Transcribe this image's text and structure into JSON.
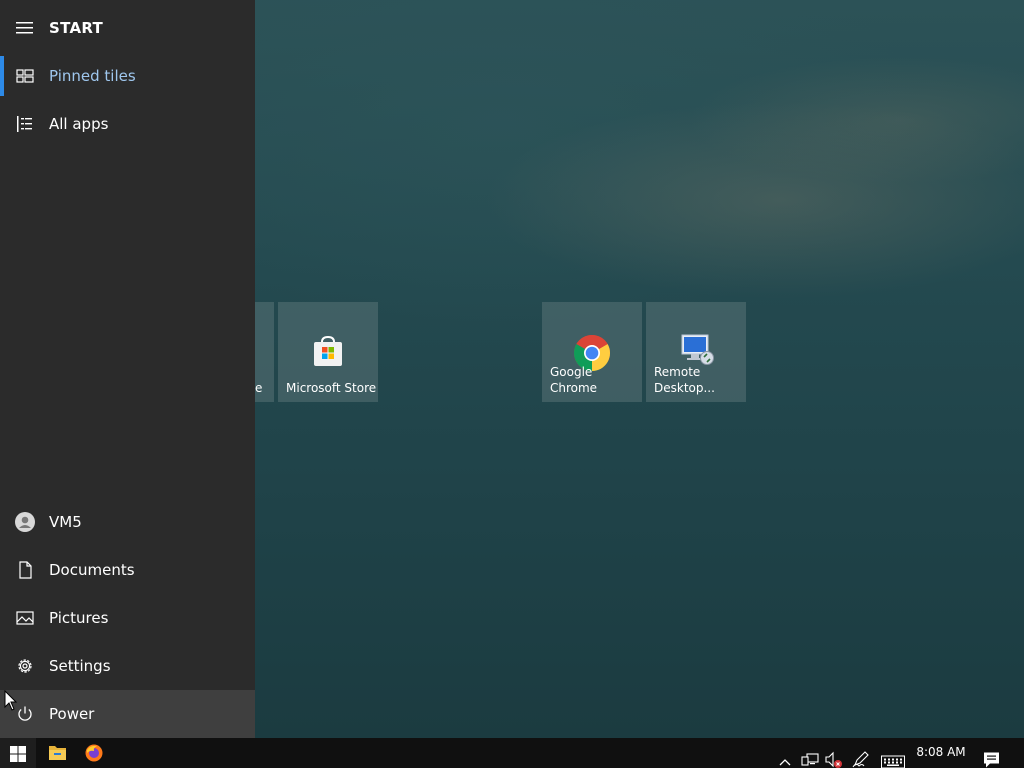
{
  "start_menu": {
    "title": "START",
    "nav_top": [
      {
        "label": "Pinned tiles",
        "icon": "pinned-tiles-icon",
        "selected": true
      },
      {
        "label": "All apps",
        "icon": "all-apps-icon",
        "selected": false
      }
    ],
    "nav_bottom": [
      {
        "label": "VM5",
        "icon": "user-avatar-icon"
      },
      {
        "label": "Documents",
        "icon": "document-icon"
      },
      {
        "label": "Pictures",
        "icon": "pictures-icon"
      },
      {
        "label": "Settings",
        "icon": "gear-icon"
      },
      {
        "label": "Power",
        "icon": "power-icon"
      }
    ]
  },
  "tiles": [
    {
      "label": "e",
      "icon": ""
    },
    {
      "label": "Microsoft Store",
      "icon": "microsoft-store-icon"
    },
    {
      "label": "Google Chrome",
      "icon": "chrome-icon"
    },
    {
      "label": "Remote Desktop...",
      "label_line1": "Remote",
      "label_line2": "Desktop...",
      "icon": "remote-desktop-icon"
    }
  ],
  "taskbar": {
    "apps": [
      "windows-start-icon",
      "file-explorer-icon",
      "firefox-icon"
    ],
    "tray": [
      "chevron-up-icon",
      "network-icon",
      "volume-muted-icon",
      "pen-icon",
      "keyboard-icon"
    ],
    "clock": "8:08 AM",
    "notification_icon": "action-center-icon"
  },
  "colors": {
    "accent": "#2d8ae8",
    "start_bg": "#2b2b2b",
    "taskbar_bg": "#101010",
    "selected_text": "#9fc7ee"
  }
}
